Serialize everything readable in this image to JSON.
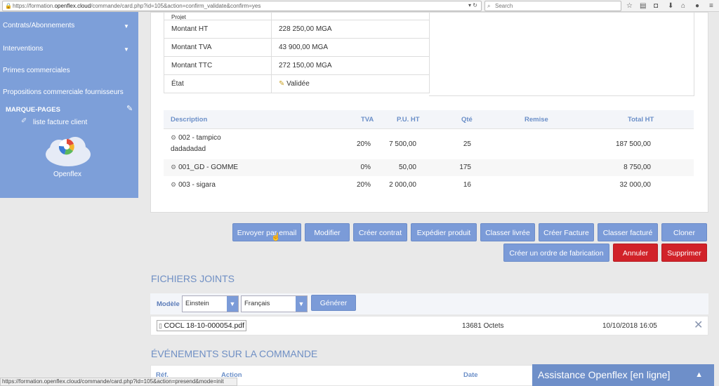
{
  "browser": {
    "url_prefix": "https://formation.",
    "url_domain": "openflex.cloud",
    "url_suffix": "/commande/card.php?id=105&action=confirm_validate&confirm=yes",
    "search_placeholder": "Search",
    "toolbar_icons": [
      "star-icon",
      "clipboard-icon",
      "pocket-icon",
      "download-icon",
      "home-icon",
      "comment-icon",
      "menu-icon"
    ]
  },
  "sidebar": {
    "items": [
      {
        "label": "Contrats/Abonnements",
        "caret": true
      },
      {
        "label": "Interventions",
        "caret": true
      },
      {
        "label": "Primes commerciales",
        "caret": false
      },
      {
        "label": "Propositions commerciale fournisseurs",
        "caret": false
      }
    ],
    "bookmarks_title": "MARQUE-PAGES",
    "bookmark_item": "liste facture client",
    "logo_text": "Openflex"
  },
  "order": {
    "partial_label": "Projet",
    "rows": [
      {
        "label": "Montant HT",
        "value": "228 250,00 MGA"
      },
      {
        "label": "Montant TVA",
        "value": "43 900,00 MGA"
      },
      {
        "label": "Montant TTC",
        "value": "272 150,00 MGA"
      },
      {
        "label": "État",
        "value": "Validée"
      }
    ]
  },
  "lines": {
    "headers": {
      "description": "Description",
      "tva": "TVA",
      "pu": "P.U. HT",
      "qty": "Qté",
      "remise": "Remise",
      "total": "Total HT"
    },
    "rows": [
      {
        "desc1": "002 - tampico",
        "desc2": "dadadadad",
        "tva": "20%",
        "pu": "7 500,00",
        "qty": "25",
        "total": "187 500,00"
      },
      {
        "desc1": "001_GD - GOMME",
        "desc2": "",
        "tva": "0%",
        "pu": "50,00",
        "qty": "175",
        "total": "8 750,00"
      },
      {
        "desc1": "003 - sigara",
        "desc2": "",
        "tva": "20%",
        "pu": "2 000,00",
        "qty": "16",
        "total": "32 000,00"
      }
    ]
  },
  "actions": {
    "row1": [
      "Envoyer par email",
      "Modifier",
      "Créer contrat",
      "Expédier produit",
      "Classer livrée",
      "Créer Facture",
      "Classer facturé",
      "Cloner"
    ],
    "row2": [
      "Créer un ordre de fabrication",
      "Annuler",
      "Supprimer"
    ]
  },
  "files": {
    "title": "FICHIERS JOINTS",
    "model_label": "Modèle",
    "model_value": "Einstein",
    "lang_value": "Français",
    "generate_label": "Générer",
    "file_name": "COCL 18-10-000054.pdf",
    "file_size": "13681 Octets",
    "file_date": "10/10/2018 16:05"
  },
  "events": {
    "title": "ÉVÉNEMENTS SUR LA COMMANDE",
    "headers": {
      "ref": "Réf.",
      "action": "Action",
      "date": "Date"
    }
  },
  "status_url": "https://formation.openflex.cloud/commande/card.php?id=105&action=presend&mode=init",
  "chat": {
    "label": "Assistance Openflex [en ligne]"
  }
}
